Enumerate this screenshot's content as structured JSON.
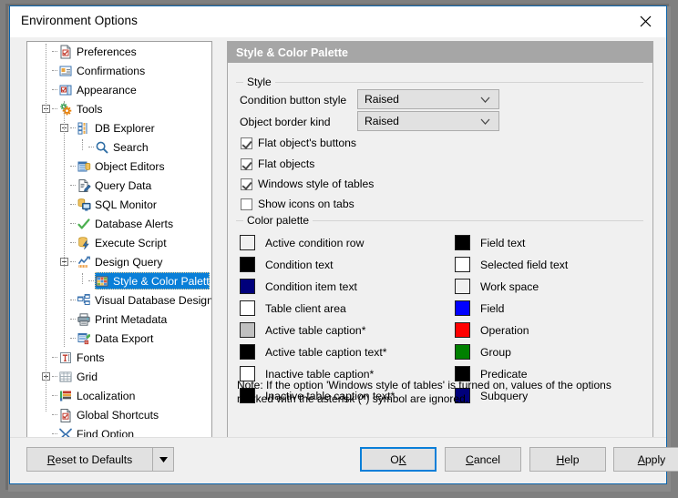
{
  "window": {
    "title": "Environment Options",
    "close_icon": "close-icon"
  },
  "tree": {
    "items": [
      {
        "label": "Preferences",
        "icon": "preferences-icon",
        "indent": 0,
        "expander": "none",
        "selected": false
      },
      {
        "label": "Confirmations",
        "icon": "confirmations-icon",
        "indent": 0,
        "expander": "none",
        "selected": false
      },
      {
        "label": "Appearance",
        "icon": "appearance-icon",
        "indent": 0,
        "expander": "none",
        "selected": false
      },
      {
        "label": "Tools",
        "icon": "tools-gear-icon",
        "indent": 0,
        "expander": "minus",
        "selected": false
      },
      {
        "label": "DB Explorer",
        "icon": "db-explorer-icon",
        "indent": 1,
        "expander": "minus",
        "selected": false
      },
      {
        "label": "Search",
        "icon": "search-icon",
        "indent": 2,
        "expander": "none",
        "selected": false
      },
      {
        "label": "Object Editors",
        "icon": "object-editors-icon",
        "indent": 1,
        "expander": "none",
        "selected": false
      },
      {
        "label": "Query Data",
        "icon": "query-data-icon",
        "indent": 1,
        "expander": "none",
        "selected": false
      },
      {
        "label": "SQL Monitor",
        "icon": "sql-monitor-icon",
        "indent": 1,
        "expander": "none",
        "selected": false
      },
      {
        "label": "Database Alerts",
        "icon": "database-alerts-icon",
        "indent": 1,
        "expander": "none",
        "selected": false
      },
      {
        "label": "Execute Script",
        "icon": "execute-script-icon",
        "indent": 1,
        "expander": "none",
        "selected": false
      },
      {
        "label": "Design Query",
        "icon": "design-query-icon",
        "indent": 1,
        "expander": "minus",
        "selected": false
      },
      {
        "label": "Style & Color Palette",
        "icon": "style-color-palette-icon",
        "indent": 2,
        "expander": "none",
        "selected": true
      },
      {
        "label": "Visual Database Designer",
        "icon": "visual-database-designer-icon",
        "indent": 1,
        "expander": "none",
        "selected": false
      },
      {
        "label": "Print Metadata",
        "icon": "print-metadata-icon",
        "indent": 1,
        "expander": "none",
        "selected": false
      },
      {
        "label": "Data Export",
        "icon": "data-export-icon",
        "indent": 1,
        "expander": "none",
        "selected": false
      },
      {
        "label": "Fonts",
        "icon": "fonts-icon",
        "indent": 0,
        "expander": "none",
        "selected": false
      },
      {
        "label": "Grid",
        "icon": "grid-icon",
        "indent": 0,
        "expander": "plus",
        "selected": false
      },
      {
        "label": "Localization",
        "icon": "localization-icon",
        "indent": 0,
        "expander": "none",
        "selected": false
      },
      {
        "label": "Global Shortcuts",
        "icon": "global-shortcuts-icon",
        "indent": 0,
        "expander": "none",
        "selected": false
      },
      {
        "label": "Find Option",
        "icon": "find-option-icon",
        "indent": 0,
        "expander": "none",
        "selected": false
      }
    ]
  },
  "panel": {
    "header": "Style & Color Palette",
    "style_group": {
      "title": "Style",
      "fields": [
        {
          "label": "Condition button style",
          "value": "Raised"
        },
        {
          "label": "Object border kind",
          "value": "Raised"
        }
      ],
      "checkboxes": [
        {
          "label": "Flat object's buttons",
          "checked": true
        },
        {
          "label": "Flat objects",
          "checked": true
        },
        {
          "label": "Windows style of tables",
          "checked": true
        },
        {
          "label": "Show icons on tabs",
          "checked": false
        }
      ]
    },
    "color_group": {
      "title": "Color palette",
      "left_column": [
        {
          "label": "Active condition row",
          "color": "#f0f0f0"
        },
        {
          "label": "Condition text",
          "color": "#000000"
        },
        {
          "label": "Condition item text",
          "color": "#00007b"
        },
        {
          "label": "Table client area",
          "color": "#ffffff"
        },
        {
          "label": "Active table caption*",
          "color": "#c0c0c0"
        },
        {
          "label": "Active table caption text*",
          "color": "#000000"
        },
        {
          "label": "Inactive table caption*",
          "color": "#ffffff"
        },
        {
          "label": "Inactive table caption text*",
          "color": "#000000"
        }
      ],
      "right_column": [
        {
          "label": "Field text",
          "color": "#000000"
        },
        {
          "label": "Selected field text",
          "color": "#ffffff"
        },
        {
          "label": "Work space",
          "color": "#f0f0f0"
        },
        {
          "label": "Field",
          "color": "#0000ff"
        },
        {
          "label": "Operation",
          "color": "#ff0000"
        },
        {
          "label": "Group",
          "color": "#008000"
        },
        {
          "label": "Predicate",
          "color": "#000000"
        },
        {
          "label": "Subquery",
          "color": "#00007b"
        }
      ]
    },
    "note": "Note: If the option 'Windows style of tables' is turned on, values of the options marked with the asterisk (*) symbol are ignored."
  },
  "buttons": {
    "reset": {
      "pre": "",
      "accel": "R",
      "post": "eset to Defaults"
    },
    "ok": {
      "pre": "O",
      "accel": "K",
      "post": ""
    },
    "cancel": {
      "pre": "",
      "accel": "C",
      "post": "ancel"
    },
    "help": {
      "pre": "",
      "accel": "H",
      "post": "elp"
    },
    "apply": {
      "pre": "",
      "accel": "A",
      "post": "pply"
    }
  },
  "colors": {
    "accent": "#0a7fd8",
    "panel_header_bg": "#a6a6a6",
    "window_bg": "#f0f0f0"
  }
}
